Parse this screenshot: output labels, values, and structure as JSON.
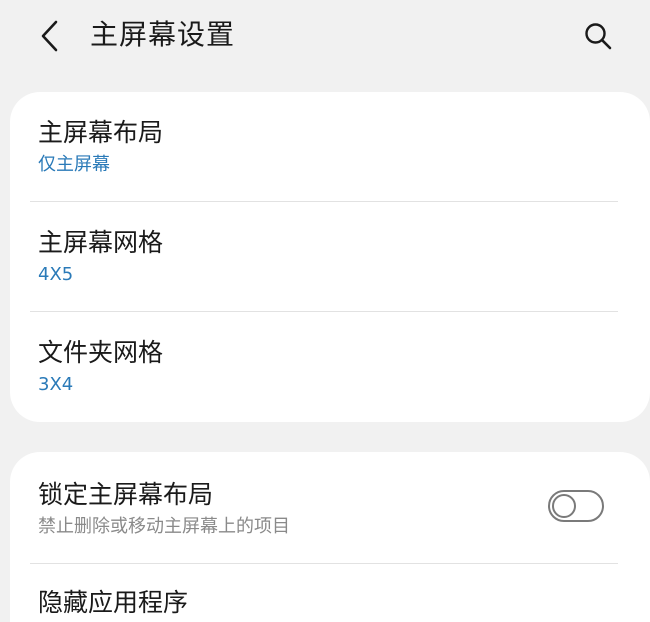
{
  "header": {
    "title": "主屏幕设置",
    "back_icon": "chevron-left-icon",
    "search_icon": "search-icon"
  },
  "group1": {
    "items": [
      {
        "title": "主屏幕布局",
        "value": "仅主屏幕"
      },
      {
        "title": "主屏幕网格",
        "value": "4X5"
      },
      {
        "title": "文件夹网格",
        "value": "3X4"
      }
    ]
  },
  "group2": {
    "lock": {
      "title": "锁定主屏幕布局",
      "description": "禁止删除或移动主屏幕上的项目",
      "enabled": false
    },
    "next_item_partial": "隐藏应用程序"
  },
  "colors": {
    "background": "#f1f1f1",
    "card": "#ffffff",
    "accent": "#2a7ab8",
    "secondary_text": "#8a8a8a"
  }
}
